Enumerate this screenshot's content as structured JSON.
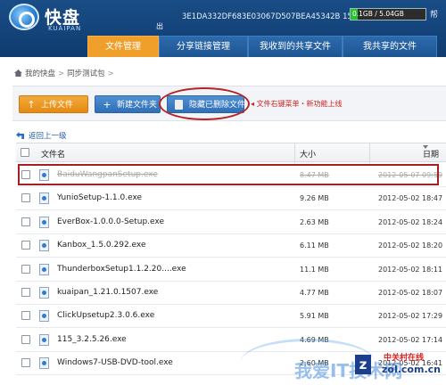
{
  "app": {
    "name": "快盘",
    "sub": "KUAIPAN",
    "caption": "出",
    "account_id": "3E1DA332DF683E03067D507BEA45342B",
    "points": "15积分",
    "quota_text": "0.1GB / 5.04GB",
    "quota_used_fraction": 0.02,
    "extra": "帮"
  },
  "nav": {
    "tabs": [
      {
        "label": "文件管理",
        "active": true
      },
      {
        "label": "分享链接管理",
        "active": false
      },
      {
        "label": "我收到的共享文件",
        "active": false
      },
      {
        "label": "我共享的文件",
        "active": false
      }
    ]
  },
  "breadcrumb": {
    "root": "我的快盘",
    "current": "同步测试包",
    "separator": ">"
  },
  "toolbar": {
    "upload_label": "上传文件",
    "newfolder_label": "新建文件夹",
    "hide_deleted_label": "隐藏已删除文件",
    "annotation": "文件右键菜单・新功能上线"
  },
  "list": {
    "back_label": "返回上一级",
    "columns": {
      "name": "文件名",
      "size": "大小",
      "date": "日期"
    },
    "rows": [
      {
        "name": "BaiduWangpanSetup.exe",
        "size": "8.47 MB",
        "date": "2012-05-07 09:59",
        "deleted": true
      },
      {
        "name": "YunioSetup-1.1.0.exe",
        "size": "9.26 MB",
        "date": "2012-05-02 18:47",
        "deleted": false
      },
      {
        "name": "EverBox-1.0.0.0-Setup.exe",
        "size": "2.63 MB",
        "date": "2012-05-02 18:24",
        "deleted": false
      },
      {
        "name": "Kanbox_1.5.0.292.exe",
        "size": "6.11 MB",
        "date": "2012-05-02 18:20",
        "deleted": false
      },
      {
        "name": "ThunderboxSetup1.1.2.20....exe",
        "size": "11.1 MB",
        "date": "2012-05-02 18:11",
        "deleted": false
      },
      {
        "name": "kuaipan_1.21.0.1507.exe",
        "size": "4.77 MB",
        "date": "2012-05-02 18:07",
        "deleted": false
      },
      {
        "name": "ClickUpsetup2.3.0.6.exe",
        "size": "5.91 MB",
        "date": "2012-05-02 17:29",
        "deleted": false
      },
      {
        "name": "115_3.2.5.26.exe",
        "size": "4.69 MB",
        "date": "2012-05-02 17:14",
        "deleted": false
      },
      {
        "name": "Windows7-USB-DVD-tool.exe",
        "size": "2.60 MB",
        "date": "2012-05-02 16:41",
        "deleted": false
      }
    ]
  },
  "watermark": {
    "text": "我爱IT技术网",
    "logo_line1": "中关村在线",
    "logo_line2": "zol.com.cn",
    "logo_mark": "z"
  }
}
